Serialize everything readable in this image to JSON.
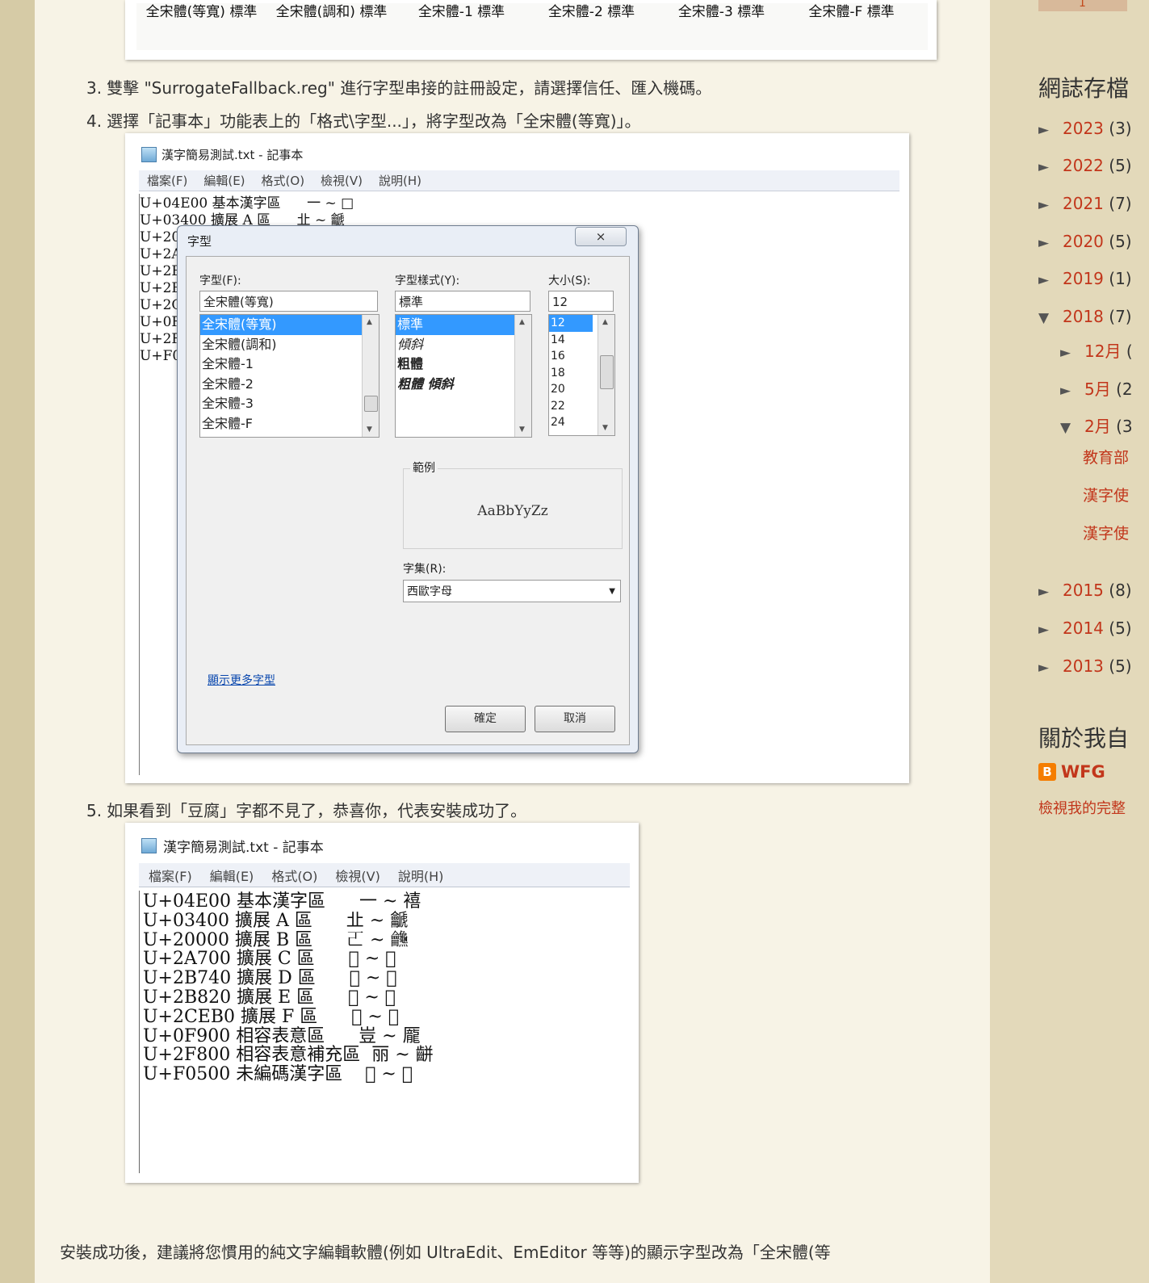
{
  "top_fonts": [
    "全宋體(等寬) 標準",
    "全宋體(調和) 標準",
    "全宋體-1 標準",
    "全宋體-2 標準",
    "全宋體-3 標準",
    "全宋體-F 標準"
  ],
  "steps": [
    {
      "num": "3.",
      "text": "雙擊 \"SurrogateFallback.reg\" 進行字型串接的註冊設定，請選擇信任、匯入機碼。"
    },
    {
      "num": "4.",
      "text": "選擇「記事本」功能表上的「格式\\字型...」，將字型改為「全宋體(等寬)」。"
    },
    {
      "num": "5.",
      "text": "如果看到「豆腐」字都不見了，恭喜你，代表安裝成功了。"
    }
  ],
  "notepad1": {
    "title": "漢字簡易測試.txt - 記事本",
    "menu": [
      "檔案(F)",
      "編輯(E)",
      "格式(O)",
      "檢視(V)",
      "說明(H)"
    ],
    "lines": "U+04E00 基本漢字區      一 ~ □\nU+03400 擴展 A 區      㐀 ~ 䶵\nU+20\nU+2A\nU+2B\nU+2B\nU+2C\nU+0F\nU+2F\nU+F0"
  },
  "font_dialog": {
    "title": "字型",
    "close": "⨯",
    "font_label": "字型(F):",
    "font_value": "全宋體(等寬)",
    "fonts": [
      "全宋體(等寬)",
      "全宋體(調和)",
      "全宋體-1",
      "全宋體-2",
      "全宋體-3",
      "全宋體-F"
    ],
    "style_label": "字型樣式(Y):",
    "style_value": "標準",
    "styles": [
      "標準",
      "傾斜",
      "粗體",
      "粗體 傾斜"
    ],
    "size_label": "大小(S):",
    "size_value": "12",
    "sizes": [
      "12",
      "14",
      "16",
      "18",
      "20",
      "22",
      "24"
    ],
    "sample_label": "範例",
    "sample_text": "AaBbYyZz",
    "charset_label": "字集(R):",
    "charset_value": "西歐字母",
    "more_fonts": "顯示更多字型",
    "ok": "確定",
    "cancel": "取消"
  },
  "notepad2": {
    "title": "漢字簡易測試.txt - 記事本",
    "menu": [
      "檔案(F)",
      "編輯(E)",
      "格式(O)",
      "檢視(V)",
      "說明(H)"
    ],
    "lines": "U+04E00 基本漢字區      一 ~ 鿋\nU+03400 擴展 A 區      㐀 ~ 䶵\nU+20000 擴展 B 區      𠀀 ~ 𪛖\nU+2A700 擴展 C 區      𪜀 ~ 𫜴\nU+2B740 擴展 D 區      𫝀 ~ 𫠝\nU+2B820 擴展 E 區      𫠠 ~ 𬺡\nU+2CEB0 擴展 F 區      𬺰 ~ 𮯠\nU+0F900 相容表意區      豈 ~ 龎\nU+2F800 相容表意補充區  丽 ~ 𪘀\nU+F0500 未編碼漢字區    𰀀 ~ 𱍊"
  },
  "paragraph": "安裝成功後，建議將您慣用的純文字編輯軟體(例如 UltraEdit、EmEditor 等等)的顯示字型改為「全宋體(等",
  "sidebar": {
    "top_tab": "1",
    "archive_title": "網誌存檔",
    "archive": [
      {
        "tri": "►",
        "year": "2023",
        "count": "(3)"
      },
      {
        "tri": "►",
        "year": "2022",
        "count": "(5)"
      },
      {
        "tri": "►",
        "year": "2021",
        "count": "(7)"
      },
      {
        "tri": "►",
        "year": "2020",
        "count": "(5)"
      },
      {
        "tri": "►",
        "year": "2019",
        "count": "(1)"
      },
      {
        "tri": "▼",
        "year": "2018",
        "count": "(7)"
      },
      {
        "tri": "►",
        "year": "12月",
        "count": "("
      },
      {
        "tri": "►",
        "year": "5月",
        "count": "(2"
      },
      {
        "tri": "▼",
        "year": "2月",
        "count": "(3"
      },
      {
        "tri": "►",
        "year": "2015",
        "count": "(8)"
      },
      {
        "tri": "►",
        "year": "2014",
        "count": "(5)"
      },
      {
        "tri": "►",
        "year": "2013",
        "count": "(5)"
      }
    ],
    "posts": [
      "教育部",
      "漢字使",
      "漢字使"
    ],
    "about_title": "關於我自",
    "blogger_name": "WFG",
    "view_profile": "檢視我的完整"
  }
}
